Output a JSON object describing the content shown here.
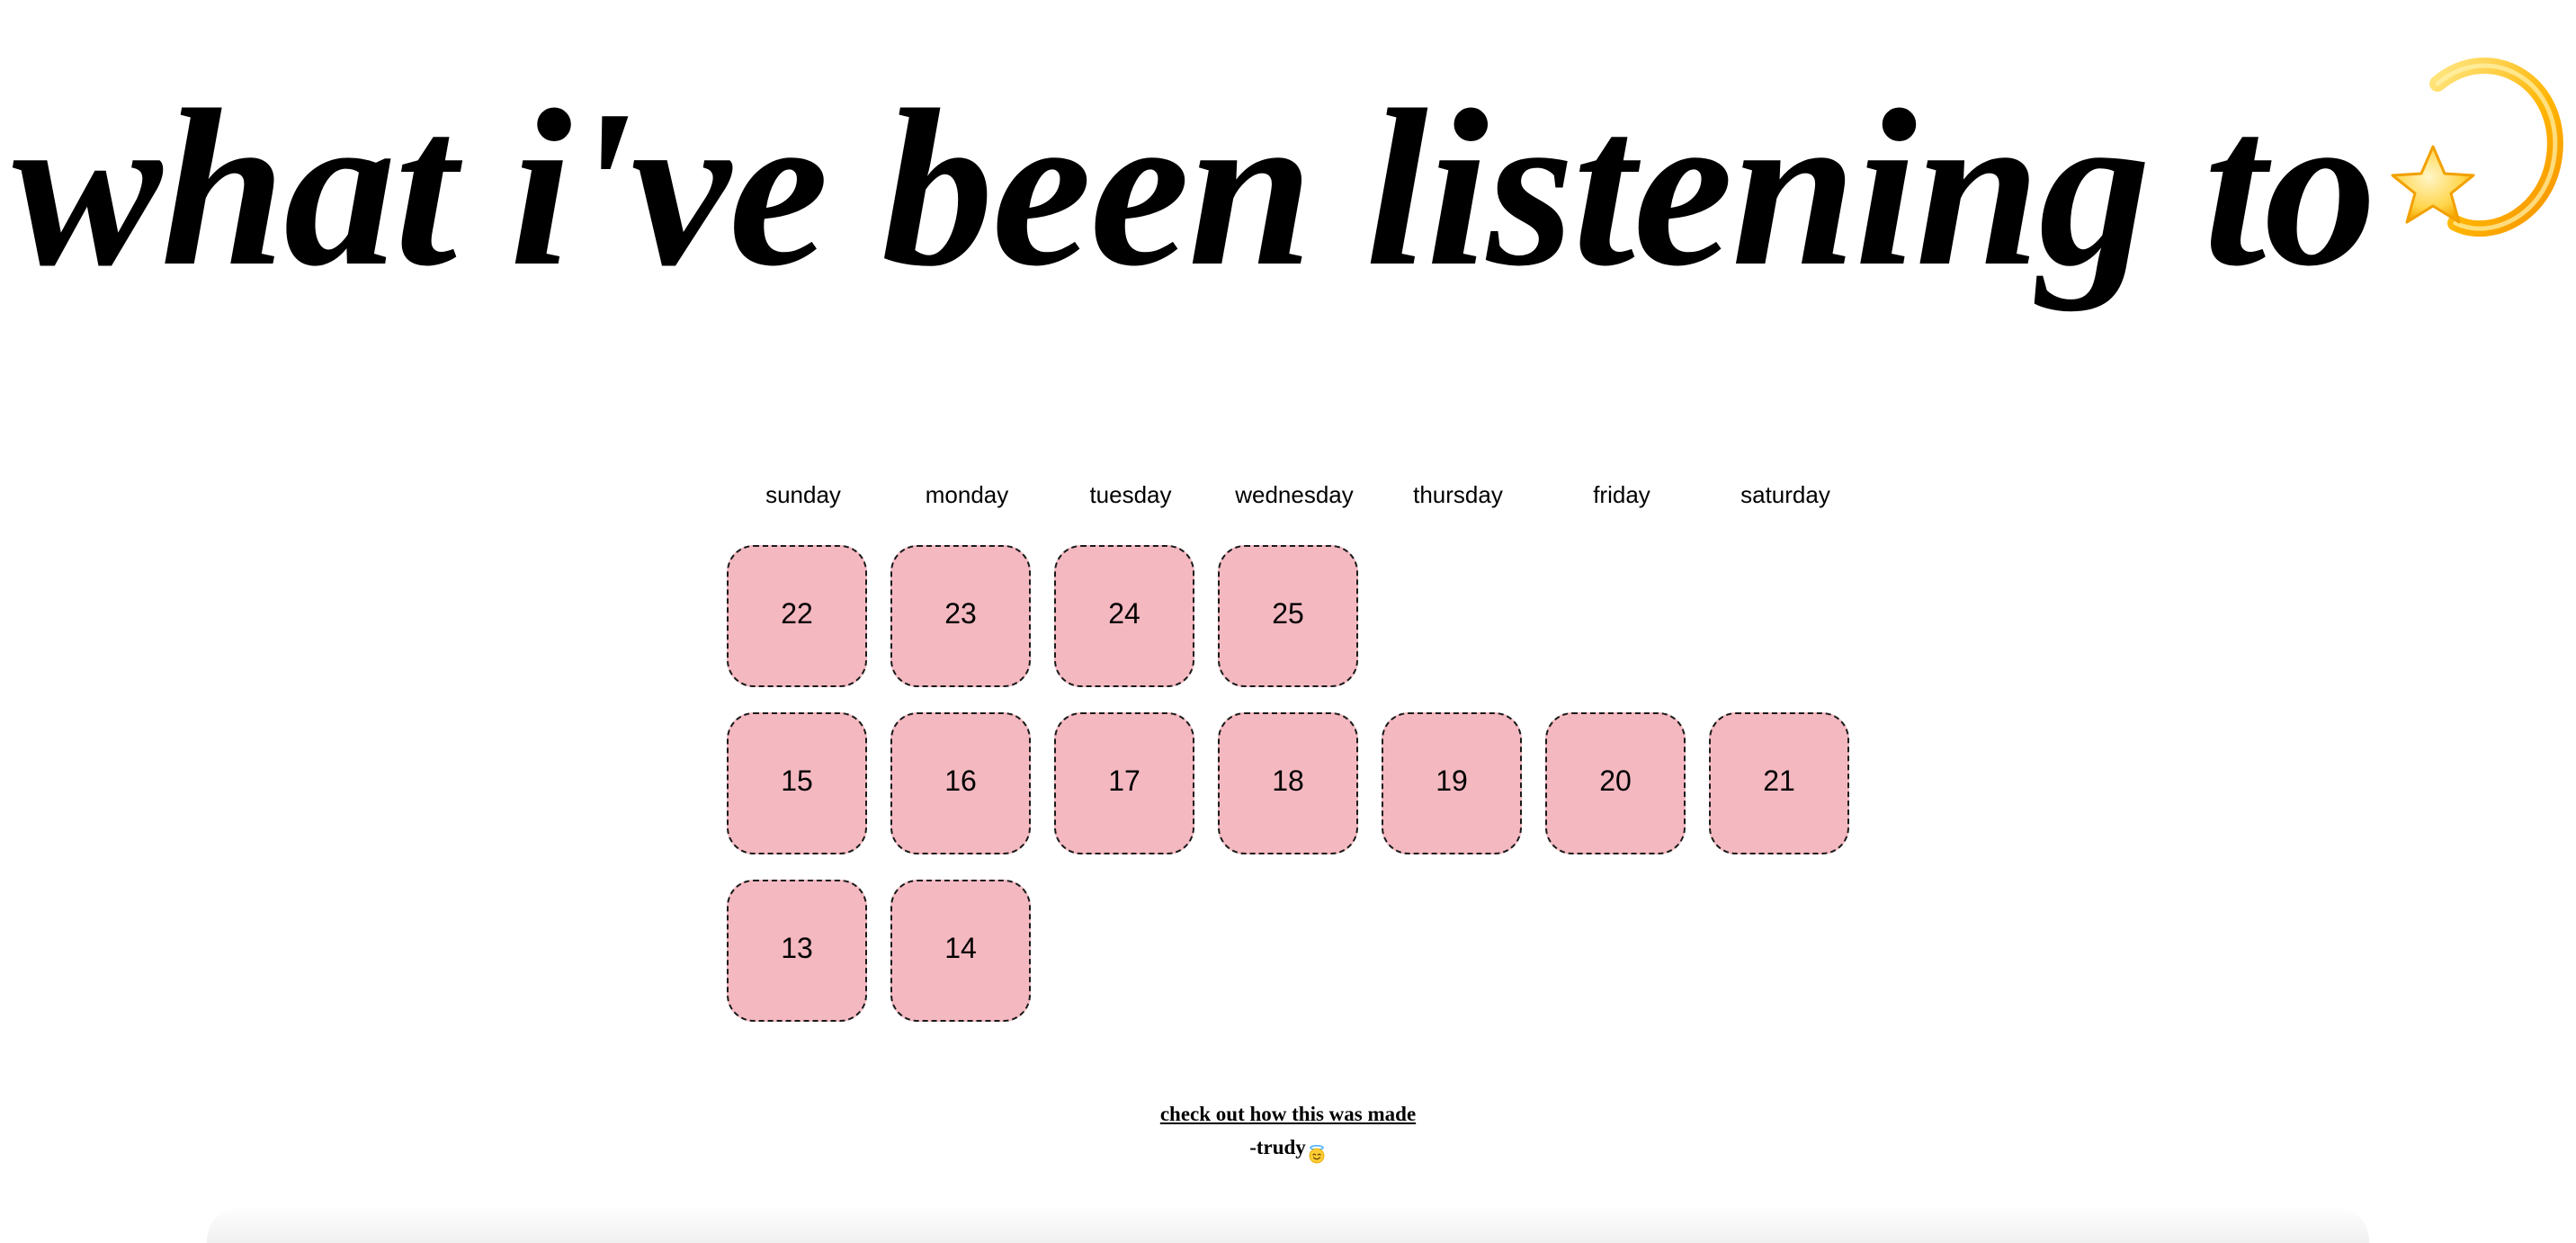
{
  "header": {
    "title": "what i've been listening to",
    "emoji_icon": "dizzy-shooting-star-icon"
  },
  "calendar": {
    "day_names": [
      "sunday",
      "monday",
      "tuesday",
      "wednesday",
      "thursday",
      "friday",
      "saturday"
    ],
    "weeks": [
      [
        "22",
        "23",
        "24",
        "25",
        "",
        "",
        ""
      ],
      [
        "15",
        "16",
        "17",
        "18",
        "19",
        "20",
        "21"
      ],
      [
        "13",
        "14",
        "",
        "",
        "",
        "",
        ""
      ]
    ],
    "cell_color": "#f4b8c0"
  },
  "footer": {
    "link_text": "check out how this was made",
    "signature": "-trudy",
    "signature_icon": "smiling-face-with-halo-icon"
  }
}
